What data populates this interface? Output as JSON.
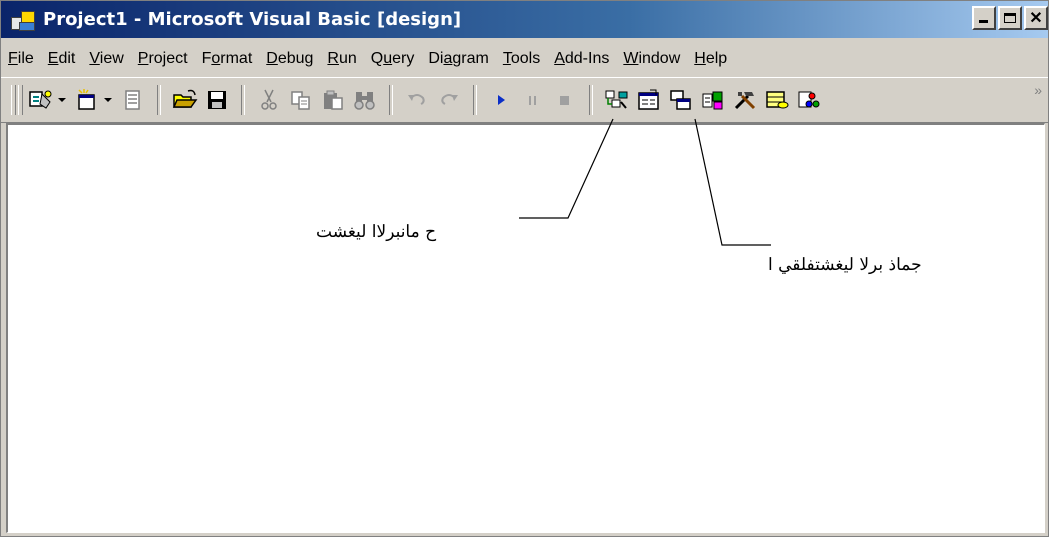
{
  "window": {
    "title": "Project1 - Microsoft Visual Basic [design]"
  },
  "menu": {
    "items": [
      {
        "label": "File",
        "accel": "F",
        "rest": "ile"
      },
      {
        "label": "Edit",
        "accel": "E",
        "rest": "dit"
      },
      {
        "label": "View",
        "accel": "V",
        "rest": "iew"
      },
      {
        "label": "Project",
        "accel": "P",
        "rest": "roject"
      },
      {
        "label": "Format",
        "pre": "F",
        "accel": "o",
        "rest": "rmat"
      },
      {
        "label": "Debug",
        "accel": "D",
        "rest": "ebug"
      },
      {
        "label": "Run",
        "accel": "R",
        "rest": "un"
      },
      {
        "label": "Query",
        "pre": "Q",
        "accel": "u",
        "rest": "ery"
      },
      {
        "label": "Diagram",
        "pre": "Di",
        "accel": "a",
        "rest": "gram"
      },
      {
        "label": "Tools",
        "accel": "T",
        "rest": "ools"
      },
      {
        "label": "Add-Ins",
        "accel": "A",
        "rest": "dd-Ins"
      },
      {
        "label": "Window",
        "accel": "W",
        "rest": "indow"
      },
      {
        "label": "Help",
        "accel": "H",
        "rest": "elp"
      }
    ]
  },
  "toolbar": {
    "buttons": [
      "add-project-icon",
      "add-form-icon",
      "menu-editor-icon",
      "open-project-icon",
      "save-project-icon",
      "cut-icon",
      "copy-icon",
      "paste-icon",
      "find-icon",
      "undo-icon",
      "redo-icon",
      "start-icon",
      "break-icon",
      "end-icon",
      "project-explorer-icon",
      "properties-window-icon",
      "form-layout-icon",
      "object-browser-icon",
      "toolbox-icon",
      "data-view-icon",
      "component-manager-icon"
    ],
    "overflow": "»"
  },
  "annotations": {
    "start_label": "ح مانبرلاا ليغشت",
    "end_label": "جماذ برلا ليغشتفلقي ا"
  },
  "colors": {
    "title_gradient_start": "#0a246a",
    "title_gradient_end": "#a6caf0",
    "face": "#d4d0c8",
    "start_blue": "#0b2ec8"
  }
}
